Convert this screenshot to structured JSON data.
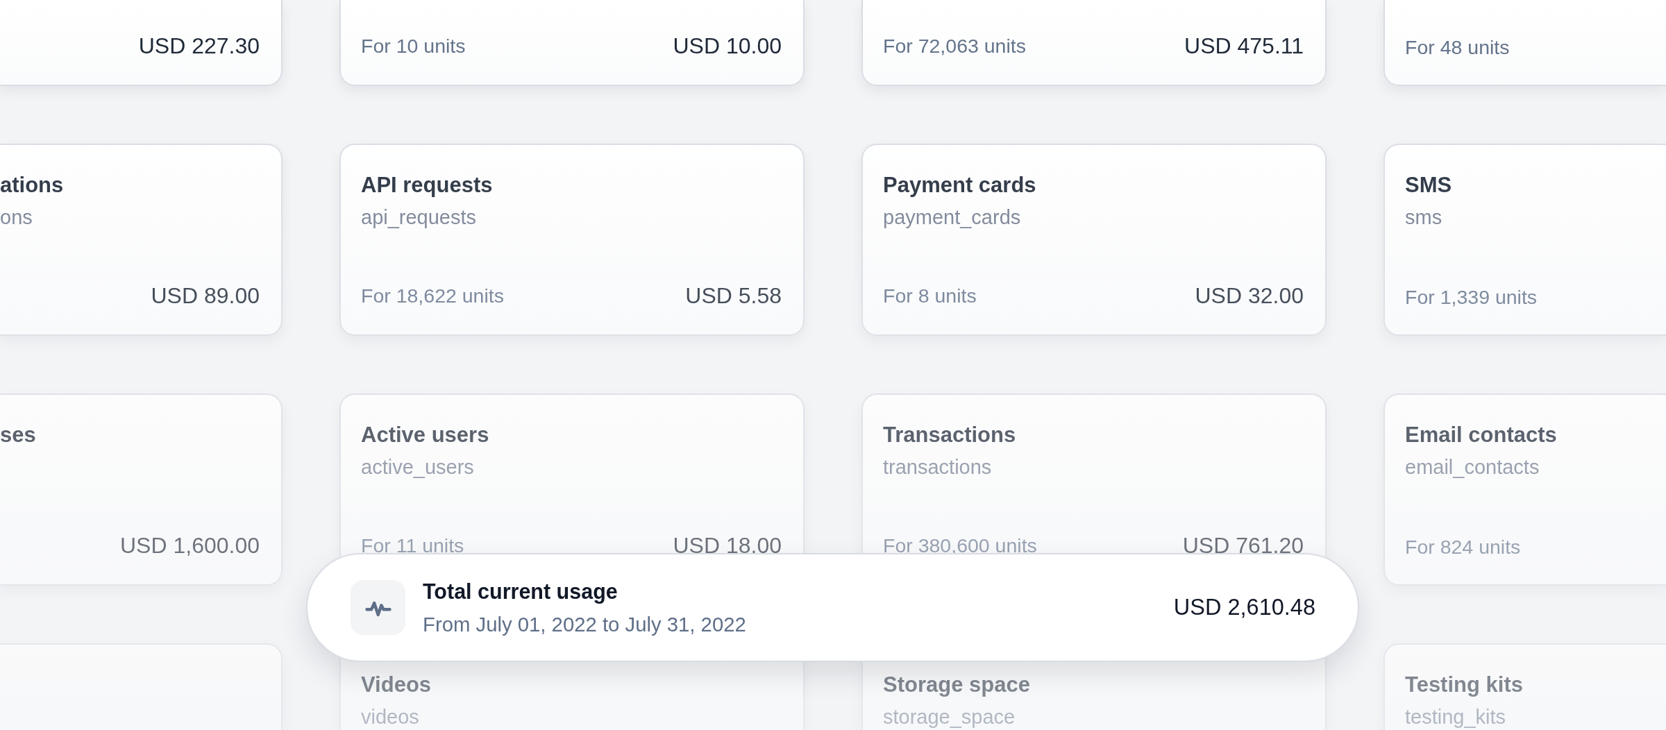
{
  "usage_grid": {
    "rows": [
      {
        "cards": [
          {
            "amount": "USD 227.30"
          },
          {
            "units": "For 10 units",
            "amount": "USD 10.00"
          },
          {
            "units": "For 72,063 units",
            "amount": "USD 475.11"
          },
          {
            "units": "For 48 units"
          }
        ]
      },
      {
        "cards": [
          {
            "title": "ations",
            "key": "ons",
            "amount": "USD 89.00"
          },
          {
            "title": "API requests",
            "key": "api_requests",
            "units": "For 18,622 units",
            "amount": "USD 5.58"
          },
          {
            "title": "Payment cards",
            "key": "payment_cards",
            "units": "For 8 units",
            "amount": "USD 32.00"
          },
          {
            "title": "SMS",
            "key": "sms",
            "units": "For 1,339 units"
          }
        ]
      },
      {
        "cards": [
          {
            "title": "ses",
            "amount": "USD 1,600.00"
          },
          {
            "title": "Active users",
            "key": "active_users",
            "units": "For 11 units",
            "amount": "USD 18.00"
          },
          {
            "title": "Transactions",
            "key": "transactions",
            "units": "For 380,600 units",
            "amount": "USD 761.20"
          },
          {
            "title": "Email contacts",
            "key": "email_contacts",
            "units": "For 824 units"
          }
        ]
      },
      {
        "cards": [
          {
            "title": "Videos",
            "key": "videos"
          },
          {
            "title": "Storage space",
            "key": "storage_space"
          },
          {
            "title": "Testing kits",
            "key": "testing_kits"
          }
        ]
      }
    ]
  },
  "total_usage": {
    "title": "Total current usage",
    "period": "From July 01, 2022 to July 31, 2022",
    "amount": "USD 2,610.48"
  }
}
